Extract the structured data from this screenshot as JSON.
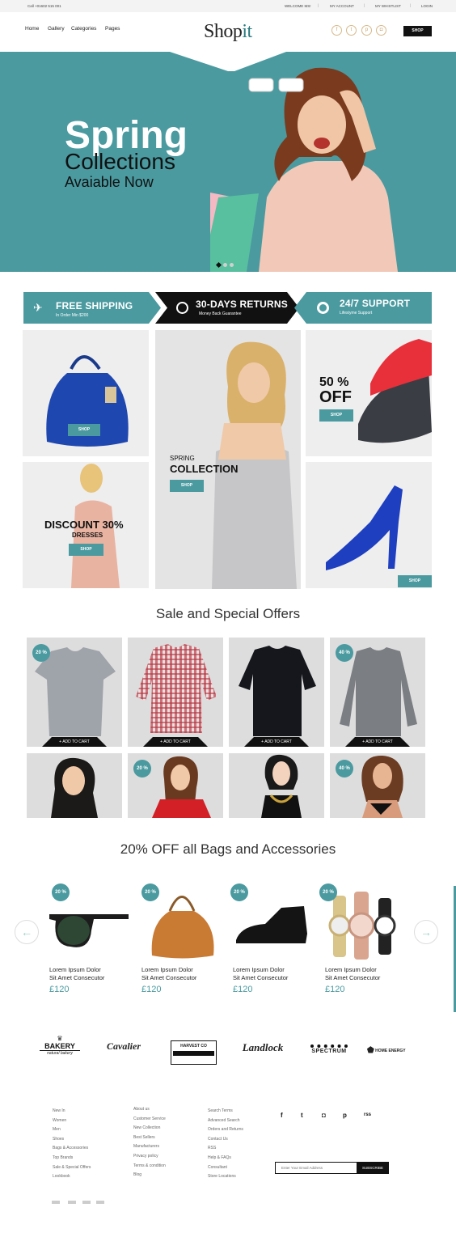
{
  "topbar": {
    "phone": "Call +01602 515 001",
    "links": [
      "WELCOME MS!",
      "MY ACCOUNT",
      "MY WHISTLIST",
      "LOGIN"
    ]
  },
  "nav": [
    "Home",
    "Gallery",
    "Categories",
    "Pages"
  ],
  "logo": {
    "main": "Shop",
    "accent": "it"
  },
  "header": {
    "shop_button": "SHOP",
    "social_icons": [
      "facebook-icon",
      "twitter-icon",
      "pinterest-icon",
      "instagram-icon"
    ]
  },
  "hero": {
    "line1": "Spring",
    "line2": "Collections",
    "line3": "Avaiable Now",
    "slide_active": 1,
    "slide_count": 3
  },
  "features": [
    {
      "title": "FREE SHIPPING",
      "sub": "In Order Min $200",
      "icon": "plane-icon"
    },
    {
      "title": "30-DAYS RETURNS",
      "sub": "Money Back  Guarantee",
      "icon": "clock-icon"
    },
    {
      "title": "24/7 SUPPORT",
      "sub": "Lifestyme Support",
      "icon": "lifebuoy-icon"
    }
  ],
  "promos": {
    "bag": {
      "button": "SHOP"
    },
    "spring": {
      "line1": "SPRING",
      "line2": "COLLECTION",
      "button": "SHOP"
    },
    "shoes": {
      "line1": "50 %",
      "line2": "OFF",
      "button": "SHOP"
    },
    "dresses": {
      "line1": "DISCOUNT 30%",
      "line2": "DRESSES",
      "button": "SHOP"
    },
    "heels": {
      "button": "SHOP"
    }
  },
  "sale": {
    "title": "Sale and Special Offers",
    "add_to_cart": "+ ADD TO CART",
    "badges": [
      "20 %",
      "40 %",
      "20 %",
      "40 %"
    ]
  },
  "bags": {
    "title": "20% OFF all Bags and Accessories",
    "badge": "20 %",
    "items": [
      {
        "name1": "Lorem Ipsum Dolor",
        "name2": "Sit Amet Consecutor",
        "price": "£120"
      },
      {
        "name1": "Lorem Ipsum Dolor",
        "name2": "Sit Amet Consecutor",
        "price": "£120"
      },
      {
        "name1": "Lorem Ipsum Dolor",
        "name2": "Sit Amet Consecutor",
        "price": "£120"
      },
      {
        "name1": "Lorem Ipsum Dolor",
        "name2": "Sit Amet Consecutor",
        "price": "£120"
      }
    ],
    "prev": "←",
    "next": "→"
  },
  "brands": [
    "BAKERY",
    "Cavalier",
    "HARVEST CO",
    "Landlock",
    "SPECTRUM",
    "HOME ENERGY"
  ],
  "footer": {
    "col1": [
      "New In",
      "Women",
      "Men",
      "Shoes",
      "Bags & Accessories",
      "Top Brands",
      "Sale & Special Offers",
      "Lookbook"
    ],
    "col2": [
      "About us",
      "Customer Service",
      "New Collection",
      "Best Sellers",
      "Manufacturers",
      "Privacy policy",
      "Terms & condition",
      "Blog"
    ],
    "col3": [
      "Search Terms",
      "Advanced Search",
      "Orders and Returns",
      "Contact Us",
      "RSS",
      "Help & FAQs",
      "Consultant",
      "Store Locations"
    ],
    "social": [
      "f",
      "t",
      "◘",
      "p",
      "rss"
    ],
    "email_placeholder": "Enter Your Email Address",
    "subscribe": "SUBSCRIBE"
  },
  "colors": {
    "accent": "#4a9aa0",
    "dark": "#111111"
  }
}
